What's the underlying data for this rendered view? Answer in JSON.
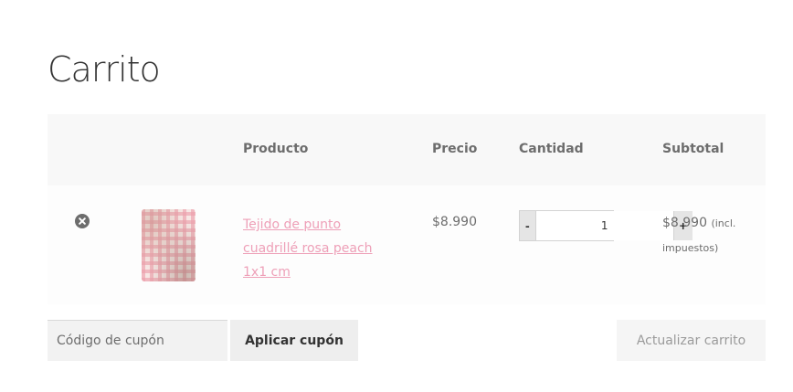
{
  "page": {
    "title": "Carrito"
  },
  "table": {
    "headers": {
      "product": "Producto",
      "price": "Precio",
      "quantity": "Cantidad",
      "subtotal": "Subtotal"
    },
    "items": [
      {
        "name": "Tejido de punto cuadrillé rosa peach 1x1 cm",
        "price": "$8.990",
        "quantity": "1",
        "subtotal": "$8.990",
        "tax_note": "(incl. impuestos)",
        "minus_label": "-",
        "plus_label": "+"
      }
    ]
  },
  "actions": {
    "coupon_placeholder": "Código de cupón",
    "apply_label": "Aplicar cupón",
    "update_label": "Actualizar carrito"
  },
  "colors": {
    "link": "#eea0b8",
    "header_bg": "#f8f8f8",
    "text": "#6d6d6d"
  },
  "icons": {
    "remove": "remove-circle-x-icon"
  }
}
